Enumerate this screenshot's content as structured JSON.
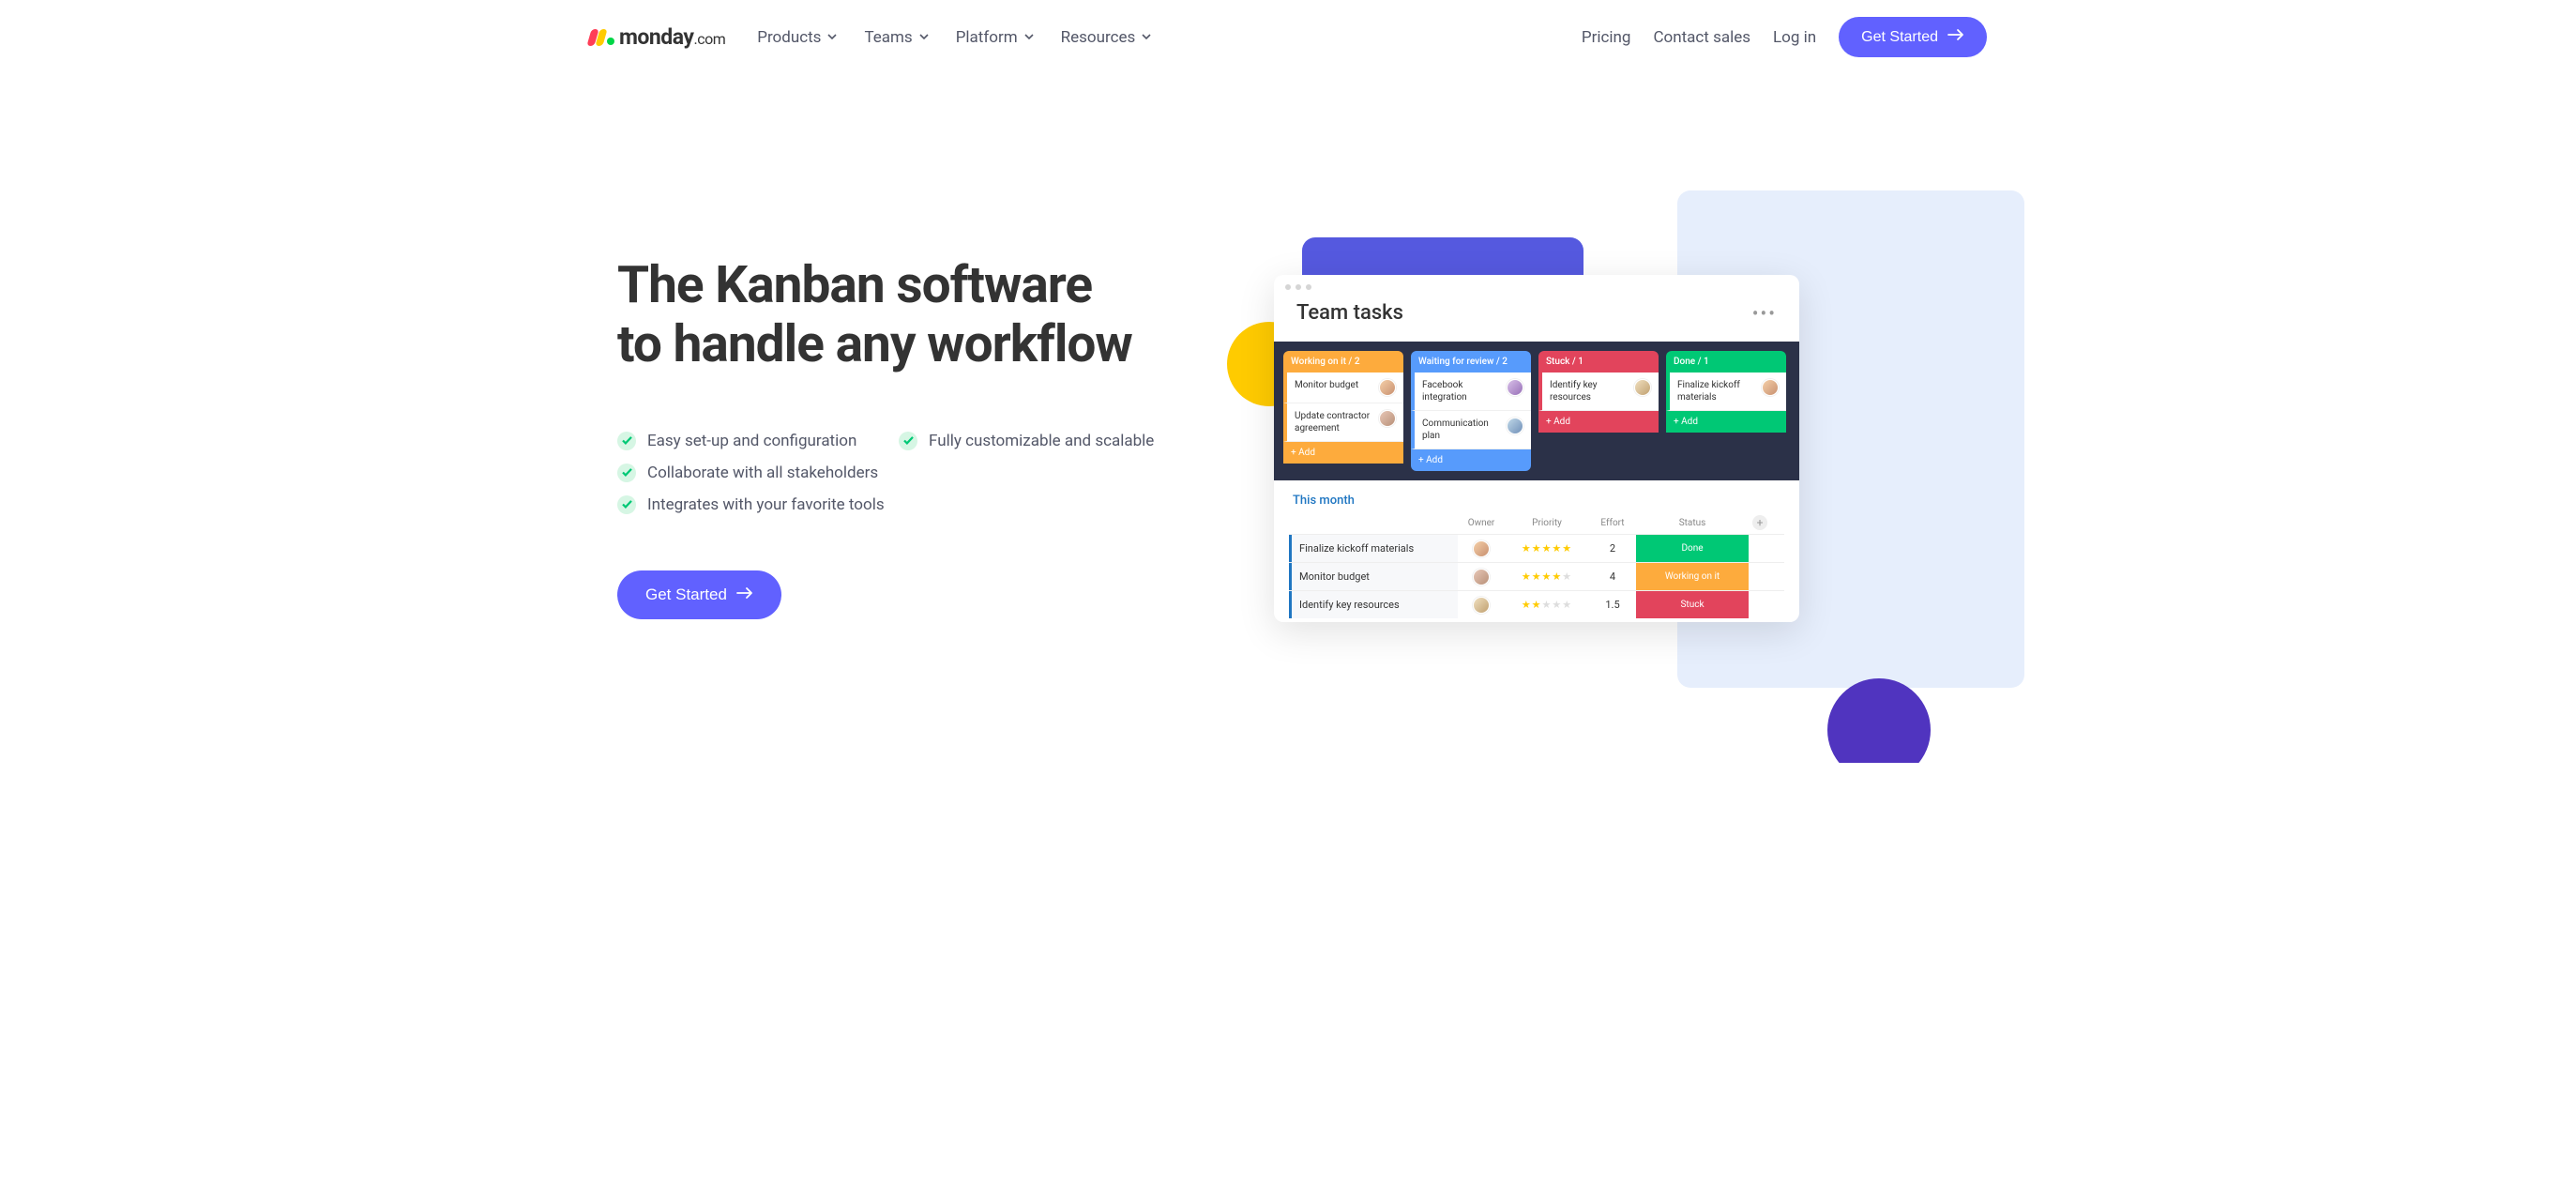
{
  "brand": {
    "name": "monday",
    "suffix": ".com"
  },
  "nav": {
    "items": [
      {
        "label": "Products"
      },
      {
        "label": "Teams"
      },
      {
        "label": "Platform"
      },
      {
        "label": "Resources"
      }
    ],
    "pricing": "Pricing",
    "contact": "Contact sales",
    "login": "Log in",
    "cta": "Get Started"
  },
  "hero": {
    "headline_l1": "The Kanban software",
    "headline_l2": "to handle any workflow",
    "bullets": [
      "Easy set-up and configuration",
      "Fully customizable and scalable",
      "Collaborate with all stakeholders",
      "Integrates with your favorite tools"
    ],
    "cta": "Get Started"
  },
  "board": {
    "title": "Team tasks",
    "columns": [
      {
        "name": "Working on it",
        "count": 2,
        "color": "orange",
        "cards": [
          {
            "text": "Monitor budget",
            "avatar": "a1"
          },
          {
            "text": "Update contractor agreement",
            "avatar": "a2"
          }
        ]
      },
      {
        "name": "Waiting for review",
        "count": 2,
        "color": "blue",
        "cards": [
          {
            "text": "Facebook integration",
            "avatar": "a3"
          },
          {
            "text": "Communication plan",
            "avatar": "a4"
          }
        ]
      },
      {
        "name": "Stuck",
        "count": 1,
        "color": "red",
        "cards": [
          {
            "text": "Identify key resources",
            "avatar": "a5"
          }
        ]
      },
      {
        "name": "Done",
        "count": 1,
        "color": "green",
        "cards": [
          {
            "text": "Finalize kickoff materials",
            "avatar": "a1"
          }
        ]
      }
    ],
    "add_label": "+ Add",
    "table": {
      "section": "This month",
      "headers": {
        "owner": "Owner",
        "priority": "Priority",
        "effort": "Effort",
        "status": "Status"
      },
      "rows": [
        {
          "name": "Finalize kickoff materials",
          "avatar": "a1",
          "priority": 5,
          "effort": "2",
          "status": "Done",
          "status_class": "st-done"
        },
        {
          "name": "Monitor budget",
          "avatar": "a2",
          "priority": 4,
          "effort": "4",
          "status": "Working on it",
          "status_class": "st-working"
        },
        {
          "name": "Identify key resources",
          "avatar": "a5",
          "priority": 2,
          "effort": "1.5",
          "status": "Stuck",
          "status_class": "st-stuck"
        }
      ]
    }
  }
}
